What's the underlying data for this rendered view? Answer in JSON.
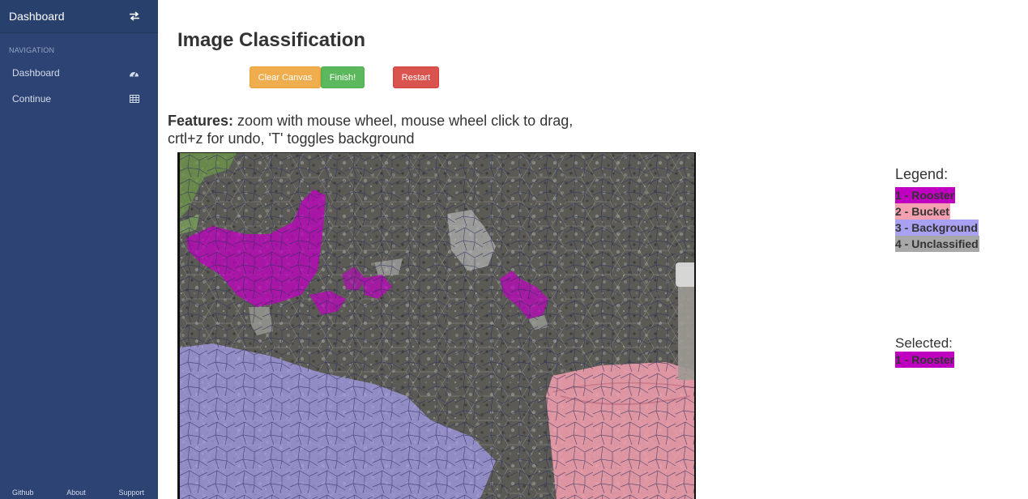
{
  "sidebar": {
    "title": "Dashboard",
    "section_label": "NAVIGATION",
    "items": [
      {
        "label": "Dashboard",
        "icon": "gauge-icon"
      },
      {
        "label": "Continue",
        "icon": "table-icon"
      }
    ],
    "footer": {
      "github": "Github",
      "about": "About",
      "support": "Support"
    }
  },
  "main": {
    "title": "Image Classification",
    "buttons": {
      "clear": "Clear Canvas",
      "finish": "Finish!",
      "restart": "Restart"
    },
    "features_label": "Features:",
    "features_text": " zoom with mouse wheel, mouse wheel click to drag,",
    "features_text_2": "crtl+z for undo, 'T' toggles background"
  },
  "legend": {
    "title": "Legend:",
    "items": [
      {
        "label": "1 - Rooster",
        "color": "#c000c0"
      },
      {
        "label": "2 - Bucket",
        "color": "#f4a0b0"
      },
      {
        "label": "3 - Background",
        "color": "#a8a0f0"
      },
      {
        "label": "4 - Unclassified",
        "color": "#a8a8a8"
      }
    ]
  },
  "selected": {
    "title": "Selected:",
    "label": "1 - Rooster",
    "color": "#c000c0"
  },
  "colors": {
    "sidebar": "#2d4373",
    "warning": "#f0ad4e",
    "success": "#5cb85c",
    "danger": "#d9534f"
  }
}
